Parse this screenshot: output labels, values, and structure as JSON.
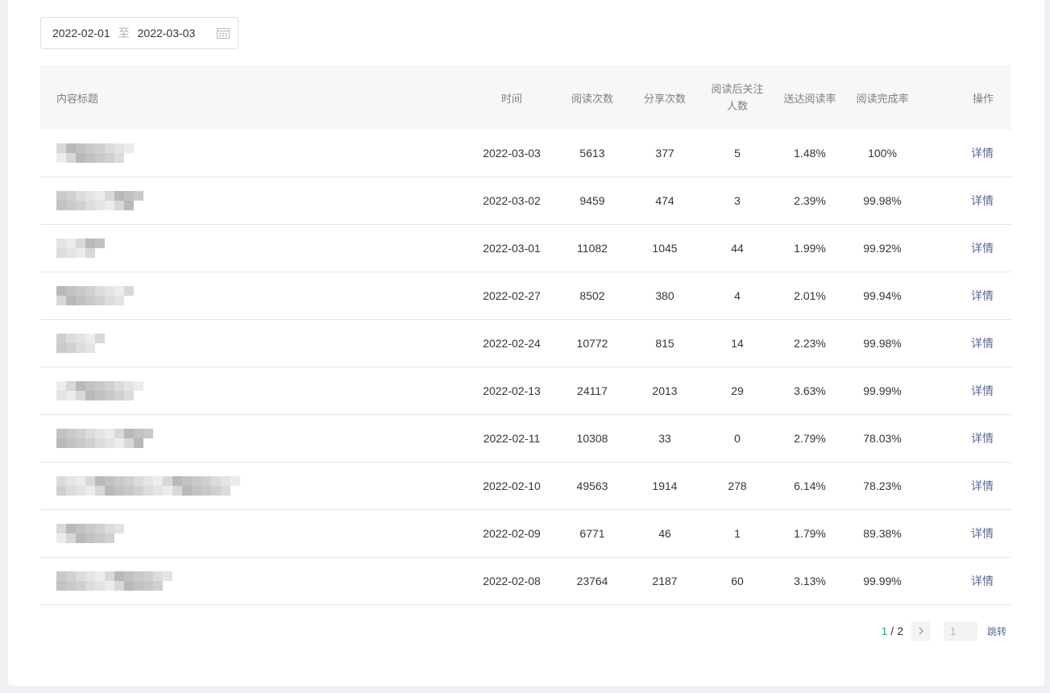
{
  "filter": {
    "start_date": "2022-02-01",
    "separator": "至",
    "end_date": "2022-03-03"
  },
  "table": {
    "headers": {
      "title": "内容标题",
      "time": "时间",
      "reads": "阅读次数",
      "shares": "分享次数",
      "follows_line1": "阅读后关注",
      "follows_line2": "人数",
      "delivery_rate": "送达阅读率",
      "completion_rate": "阅读完成率",
      "action": "操作"
    },
    "rows": [
      {
        "time": "2022-03-03",
        "reads": "5613",
        "shares": "377",
        "follows": "5",
        "delivery_rate": "1.48%",
        "completion_rate": "100%",
        "action": "详情"
      },
      {
        "time": "2022-03-02",
        "reads": "9459",
        "shares": "474",
        "follows": "3",
        "delivery_rate": "2.39%",
        "completion_rate": "99.98%",
        "action": "详情"
      },
      {
        "time": "2022-03-01",
        "reads": "11082",
        "shares": "1045",
        "follows": "44",
        "delivery_rate": "1.99%",
        "completion_rate": "99.92%",
        "action": "详情"
      },
      {
        "time": "2022-02-27",
        "reads": "8502",
        "shares": "380",
        "follows": "4",
        "delivery_rate": "2.01%",
        "completion_rate": "99.94%",
        "action": "详情"
      },
      {
        "time": "2022-02-24",
        "reads": "10772",
        "shares": "815",
        "follows": "14",
        "delivery_rate": "2.23%",
        "completion_rate": "99.98%",
        "action": "详情"
      },
      {
        "time": "2022-02-13",
        "reads": "24117",
        "shares": "2013",
        "follows": "29",
        "delivery_rate": "3.63%",
        "completion_rate": "99.99%",
        "action": "详情"
      },
      {
        "time": "2022-02-11",
        "reads": "10308",
        "shares": "33",
        "follows": "0",
        "delivery_rate": "2.79%",
        "completion_rate": "78.03%",
        "action": "详情"
      },
      {
        "time": "2022-02-10",
        "reads": "49563",
        "shares": "1914",
        "follows": "278",
        "delivery_rate": "6.14%",
        "completion_rate": "78.23%",
        "action": "详情"
      },
      {
        "time": "2022-02-09",
        "reads": "6771",
        "shares": "46",
        "follows": "1",
        "delivery_rate": "1.79%",
        "completion_rate": "89.38%",
        "action": "详情"
      },
      {
        "time": "2022-02-08",
        "reads": "23764",
        "shares": "2187",
        "follows": "60",
        "delivery_rate": "3.13%",
        "completion_rate": "99.99%",
        "action": "详情"
      }
    ]
  },
  "pagination": {
    "current": "1",
    "separator": "/",
    "total": "2",
    "next_icon": "chevron-right-icon",
    "input_value": "1",
    "jump_label": "跳转"
  }
}
